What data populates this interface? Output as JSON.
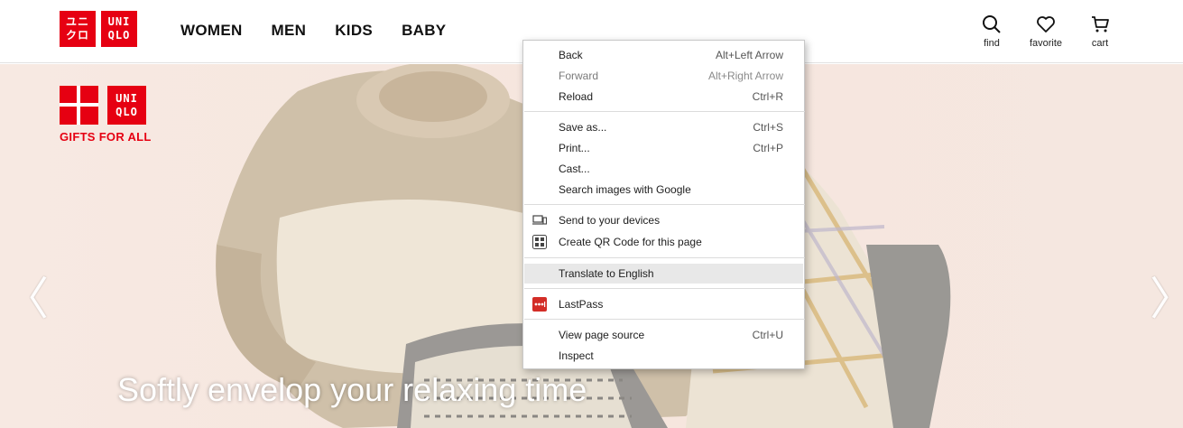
{
  "header": {
    "logo_top": "UNI",
    "logo_bottom": "QLO",
    "logo_jp_top": "ユニ",
    "logo_jp_bottom": "クロ",
    "nav": [
      "WOMEN",
      "MEN",
      "KIDS",
      "BABY"
    ],
    "utilities": {
      "find": {
        "label": "find",
        "icon": "search-icon"
      },
      "favorite": {
        "label": "favorite",
        "icon": "heart-icon"
      },
      "cart": {
        "label": "cart",
        "icon": "cart-icon"
      }
    }
  },
  "hero": {
    "gift_logo_top": "UNI",
    "gift_logo_bottom": "QLO",
    "gift_tagline": "GIFTS FOR ALL",
    "caption": "Softly envelop your relaxing time",
    "prev_arrow": "〈",
    "next_arrow": "〉"
  },
  "context_menu": {
    "back": {
      "label": "Back",
      "shortcut": "Alt+Left Arrow"
    },
    "forward": {
      "label": "Forward",
      "shortcut": "Alt+Right Arrow"
    },
    "reload": {
      "label": "Reload",
      "shortcut": "Ctrl+R"
    },
    "save_as": {
      "label": "Save as...",
      "shortcut": "Ctrl+S"
    },
    "print": {
      "label": "Print...",
      "shortcut": "Ctrl+P"
    },
    "cast": {
      "label": "Cast..."
    },
    "search_images": {
      "label": "Search images with Google"
    },
    "send_devices": {
      "label": "Send to your devices",
      "icon": "devices-icon"
    },
    "qr_code": {
      "label": "Create QR Code for this page",
      "icon": "qr-code-icon"
    },
    "translate": {
      "label": "Translate to English"
    },
    "lastpass": {
      "label": "LastPass",
      "icon": "lastpass-icon"
    },
    "view_source": {
      "label": "View page source",
      "shortcut": "Ctrl+U"
    },
    "inspect": {
      "label": "Inspect"
    }
  },
  "colors": {
    "brand_red": "#e60012",
    "highlight": "#e8e8e8"
  }
}
